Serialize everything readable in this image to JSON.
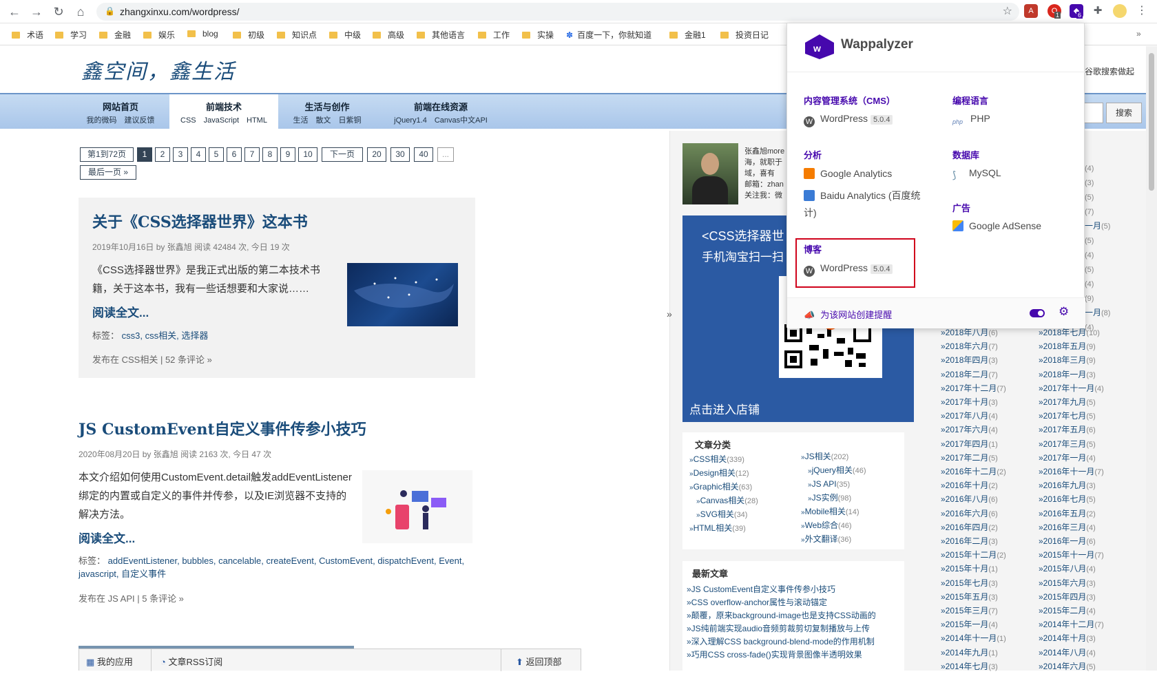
{
  "browser": {
    "url": "zhangxinxu.com/wordpress/",
    "extension_badges": [
      "1",
      "6"
    ]
  },
  "bookmarks": [
    "术语",
    "学习",
    "金融",
    "娱乐",
    "blog",
    "初级",
    "知识点",
    "中级",
    "高级",
    "其他语言",
    "工作",
    "实操",
    "百度一下，你就知道",
    "金融1",
    "投资日记"
  ],
  "header": {
    "logo": "鑫空间，鑫生活",
    "top_right": "谷歌搜索做起"
  },
  "nav": [
    {
      "title": "网站首页",
      "sub": "我的微码　建议反馈"
    },
    {
      "title": "前端技术",
      "sub": "CSS　JavaScript　HTML"
    },
    {
      "title": "生活与创作",
      "sub": "生活　散文　日紫铜"
    },
    {
      "title": "前端在线资源",
      "sub": "jQuery1.4　Canvas中文API"
    }
  ],
  "search": {
    "button": "搜索"
  },
  "pagination": {
    "summary": "第1到72页",
    "pages": [
      "1",
      "2",
      "3",
      "4",
      "5",
      "6",
      "7",
      "8",
      "9",
      "10"
    ],
    "next": "下一页",
    "more_pages": [
      "20",
      "30",
      "40",
      "..."
    ],
    "last": "最后一页 »"
  },
  "posts": [
    {
      "title": "关于《CSS选择器世界》这本书",
      "meta": "2019年10月16日 by 张鑫旭 阅读 42484 次, 今日 19 次",
      "excerpt": "《CSS选择器世界》是我正式出版的第二本技术书籍，关于这本书，我有一些话想要和大家说……",
      "more": "阅读全文...",
      "tags_label": "标签：",
      "tags": "css3, css相关, 选择器",
      "category": "发布在 CSS相关 | 52 条评论 »"
    },
    {
      "title": "JS CustomEvent自定义事件传参小技巧",
      "meta": "2020年08月20日 by 张鑫旭 阅读 2163 次, 今日 47 次",
      "excerpt": "本文介绍如何使用CustomEvent.detail触发addEventListener绑定的内置或自定义的事件并传参，以及IE浏览器不支持的解决方法。",
      "more": "阅读全文...",
      "tags_label": "标签：",
      "tags": "addEventListener, bubbles, cancelable, createEvent, CustomEvent, dispatchEvent, Event, javascript, 自定义事件",
      "category": "发布在 JS API | 5 条评论 »"
    }
  ],
  "sidebar": {
    "profile_lines": [
      "张鑫旭more",
      "海，就职于",
      "域，喜有",
      "邮箱：zhan",
      "关注我：微"
    ],
    "ad_title": "<CSS选择器世",
    "ad_sub": "手机淘宝扫一扫",
    "ad_link": "点击进入店铺",
    "categories_title": "文章分类",
    "categories_left": [
      {
        "name": "CSS相关",
        "count": "(339)",
        "indent": false
      },
      {
        "name": "Design相关",
        "count": "(12)",
        "indent": false
      },
      {
        "name": "Graphic相关",
        "count": "(63)",
        "indent": false
      },
      {
        "name": "Canvas相关",
        "count": "(28)",
        "indent": true
      },
      {
        "name": "SVG相关",
        "count": "(34)",
        "indent": true
      },
      {
        "name": "HTML相关",
        "count": "(39)",
        "indent": false
      }
    ],
    "categories_right": [
      {
        "name": "JS相关",
        "count": "(202)",
        "indent": false
      },
      {
        "name": "jQuery相关",
        "count": "(46)",
        "indent": true
      },
      {
        "name": "JS API",
        "count": "(35)",
        "indent": true
      },
      {
        "name": "JS实例",
        "count": "(98)",
        "indent": true
      },
      {
        "name": "Mobile相关",
        "count": "(14)",
        "indent": false
      },
      {
        "name": "Web综合",
        "count": "(46)",
        "indent": false
      },
      {
        "name": "外文翻译",
        "count": "(36)",
        "indent": false
      }
    ],
    "recent_title": "最新文章",
    "recent": [
      "JS CustomEvent自定义事件传参小技巧",
      "CSS overflow-anchor属性与滚动锚定",
      "颠覆，原来background-image也是支持CSS动画的",
      "JS纯前端实现audio音频剪裁剪切复制播放与上传",
      "深入理解CSS background-blend-mode的作用机制",
      "巧用CSS cross-fade()实现背景图像半透明效果"
    ],
    "archive_partial": [
      {
        "name": "",
        "count": "(4)"
      },
      {
        "name": "",
        "count": "(3)"
      },
      {
        "name": "",
        "count": "(5)"
      },
      {
        "name": "",
        "count": "(7)"
      },
      {
        "name": "一月",
        "count": "(5)"
      },
      {
        "name": "",
        "count": "(5)"
      },
      {
        "name": "",
        "count": "(4)"
      },
      {
        "name": "",
        "count": "(5)"
      },
      {
        "name": "",
        "count": "(4)"
      },
      {
        "name": "",
        "count": "(9)"
      },
      {
        "name": "一月",
        "count": "(8)"
      },
      {
        "name": "",
        "count": "(4)"
      }
    ],
    "archive_left": [
      {
        "name": "2018年八月",
        "count": "(6)"
      },
      {
        "name": "2018年六月",
        "count": "(7)"
      },
      {
        "name": "2018年四月",
        "count": "(3)"
      },
      {
        "name": "2018年二月",
        "count": "(7)"
      },
      {
        "name": "2017年十二月",
        "count": "(7)"
      },
      {
        "name": "2017年十月",
        "count": "(3)"
      },
      {
        "name": "2017年八月",
        "count": "(4)"
      },
      {
        "name": "2017年六月",
        "count": "(4)"
      },
      {
        "name": "2017年四月",
        "count": "(1)"
      },
      {
        "name": "2017年二月",
        "count": "(5)"
      },
      {
        "name": "2016年十二月",
        "count": "(2)"
      },
      {
        "name": "2016年十月",
        "count": "(2)"
      },
      {
        "name": "2016年八月",
        "count": "(6)"
      },
      {
        "name": "2016年六月",
        "count": "(6)"
      },
      {
        "name": "2016年四月",
        "count": "(2)"
      },
      {
        "name": "2016年二月",
        "count": "(3)"
      },
      {
        "name": "2015年十二月",
        "count": "(2)"
      },
      {
        "name": "2015年十月",
        "count": "(1)"
      },
      {
        "name": "2015年七月",
        "count": "(3)"
      },
      {
        "name": "2015年五月",
        "count": "(3)"
      },
      {
        "name": "2015年三月",
        "count": "(7)"
      },
      {
        "name": "2015年一月",
        "count": "(4)"
      },
      {
        "name": "2014年十一月",
        "count": "(1)"
      },
      {
        "name": "2014年九月",
        "count": "(1)"
      },
      {
        "name": "2014年七月",
        "count": "(3)"
      }
    ],
    "archive_right": [
      {
        "name": "2018年七月",
        "count": "(10)"
      },
      {
        "name": "2018年五月",
        "count": "(9)"
      },
      {
        "name": "2018年三月",
        "count": "(9)"
      },
      {
        "name": "2018年一月",
        "count": "(3)"
      },
      {
        "name": "2017年十一月",
        "count": "(4)"
      },
      {
        "name": "2017年九月",
        "count": "(5)"
      },
      {
        "name": "2017年七月",
        "count": "(5)"
      },
      {
        "name": "2017年五月",
        "count": "(6)"
      },
      {
        "name": "2017年三月",
        "count": "(5)"
      },
      {
        "name": "2017年一月",
        "count": "(4)"
      },
      {
        "name": "2016年十一月",
        "count": "(7)"
      },
      {
        "name": "2016年九月",
        "count": "(3)"
      },
      {
        "name": "2016年七月",
        "count": "(5)"
      },
      {
        "name": "2016年五月",
        "count": "(2)"
      },
      {
        "name": "2016年三月",
        "count": "(4)"
      },
      {
        "name": "2016年一月",
        "count": "(6)"
      },
      {
        "name": "2015年十一月",
        "count": "(7)"
      },
      {
        "name": "2015年八月",
        "count": "(4)"
      },
      {
        "name": "2015年六月",
        "count": "(3)"
      },
      {
        "name": "2015年四月",
        "count": "(3)"
      },
      {
        "name": "2015年二月",
        "count": "(4)"
      },
      {
        "name": "2014年十二月",
        "count": "(7)"
      },
      {
        "name": "2014年十月",
        "count": "(3)"
      },
      {
        "name": "2014年八月",
        "count": "(4)"
      },
      {
        "name": "2014年六月",
        "count": "(5)"
      }
    ]
  },
  "bottom_bar": {
    "apps": "我的应用",
    "rss": "文章RSS订阅",
    "top": "返回顶部"
  },
  "collapse_arrow": "»",
  "wappalyzer": {
    "brand": "Wappalyzer",
    "groups": [
      {
        "category": "内容管理系统（CMS）",
        "techs": [
          {
            "name": "WordPress",
            "version": "5.0.4",
            "icon": "wordpress-icon",
            "color": "#555555"
          }
        ]
      },
      {
        "category": "编程语言",
        "techs": [
          {
            "name": "PHP",
            "version": "",
            "icon": "php-icon",
            "color": "#6181b6"
          }
        ]
      },
      {
        "category": "分析",
        "techs": [
          {
            "name": "Google Analytics",
            "version": "",
            "icon": "google-analytics-icon",
            "color": "#f57c00"
          },
          {
            "name": "Baidu Analytics (百度统计)",
            "version": "",
            "icon": "baidu-analytics-icon",
            "color": "#3a7bd5"
          }
        ]
      },
      {
        "category": "数据库",
        "techs": [
          {
            "name": "MySQL",
            "version": "",
            "icon": "mysql-icon",
            "color": "#5d87a1"
          }
        ]
      },
      {
        "category": "广告",
        "techs": [
          {
            "name": "Google AdSense",
            "version": "",
            "icon": "adsense-icon",
            "color": "#fbbc04"
          }
        ]
      },
      {
        "category": "博客",
        "techs": [
          {
            "name": "WordPress",
            "version": "5.0.4",
            "icon": "wordpress-icon",
            "color": "#555555"
          }
        ]
      }
    ],
    "alert_link": "为该网站创建提醒",
    "accent": "#4608ad",
    "highlight_color": "#d0021b"
  }
}
